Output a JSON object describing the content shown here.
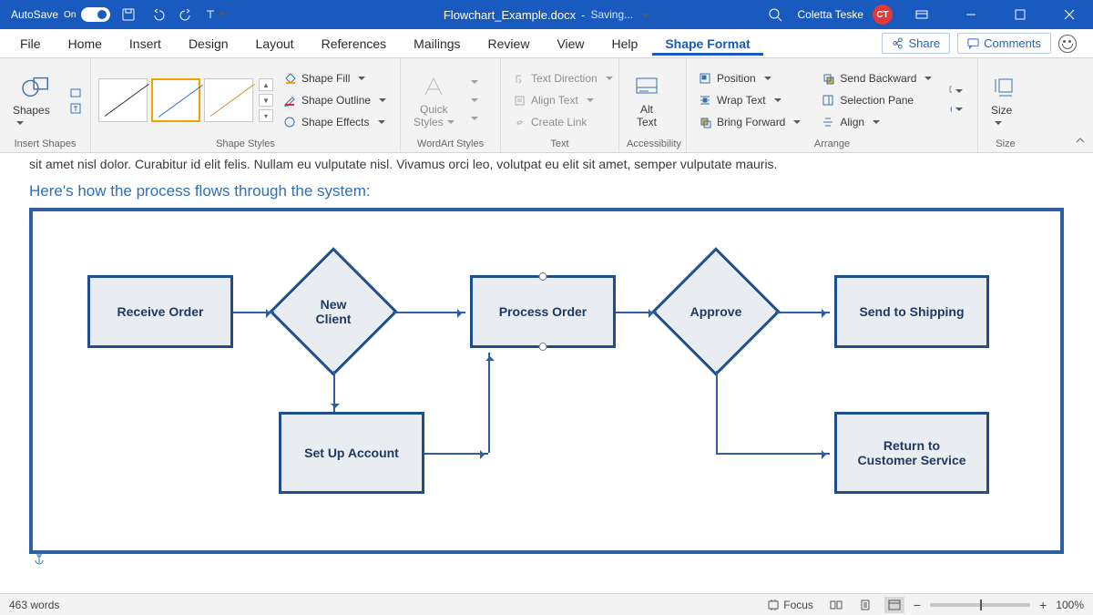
{
  "titlebar": {
    "autosave_label": "AutoSave",
    "autosave_state": "On",
    "doc_name": "Flowchart_Example.docx",
    "saving_label": "Saving...",
    "user_name": "Coletta Teske",
    "user_initials": "CT"
  },
  "tabs": {
    "items": [
      "File",
      "Home",
      "Insert",
      "Design",
      "Layout",
      "References",
      "Mailings",
      "Review",
      "View",
      "Help",
      "Shape Format"
    ],
    "active_index": 10,
    "share_label": "Share",
    "comments_label": "Comments"
  },
  "ribbon": {
    "groups": {
      "insert_shapes": {
        "label": "Insert Shapes",
        "shapes_btn": "Shapes"
      },
      "shape_styles": {
        "label": "Shape Styles",
        "shape_fill": "Shape Fill",
        "shape_outline": "Shape Outline",
        "shape_effects": "Shape Effects"
      },
      "wordart_styles": {
        "label": "WordArt Styles",
        "quick_styles": "Quick\nStyles"
      },
      "text": {
        "label": "Text",
        "text_direction": "Text Direction",
        "align_text": "Align Text",
        "create_link": "Create Link"
      },
      "accessibility": {
        "label": "Accessibility",
        "alt_text": "Alt\nText"
      },
      "arrange": {
        "label": "Arrange",
        "position": "Position",
        "wrap_text": "Wrap Text",
        "bring_forward": "Bring Forward",
        "send_backward": "Send Backward",
        "selection_pane": "Selection Pane",
        "align": "Align"
      },
      "size": {
        "label": "Size",
        "size_btn": "Size"
      }
    }
  },
  "document": {
    "cut_text": "sit amet nisl dolor. Curabitur id elit felis. Nullam eu vulputate nisl. Vivamus orci leo, volutpat eu elit sit amet, semper vulputate mauris.",
    "lead_text": "Here's how the process flows through the system:",
    "flowchart": {
      "receive_order": "Receive Order",
      "new_client": "New\nClient",
      "process_order": "Process Order",
      "approve": "Approve",
      "send_shipping": "Send to Shipping",
      "setup_account": "Set Up Account",
      "return_cs": "Return to\nCustomer Service"
    }
  },
  "statusbar": {
    "word_count": "463 words",
    "focus_label": "Focus",
    "zoom_level": "100%"
  },
  "colors": {
    "brand": "#185abd",
    "shape_border": "#1e4e8c"
  }
}
